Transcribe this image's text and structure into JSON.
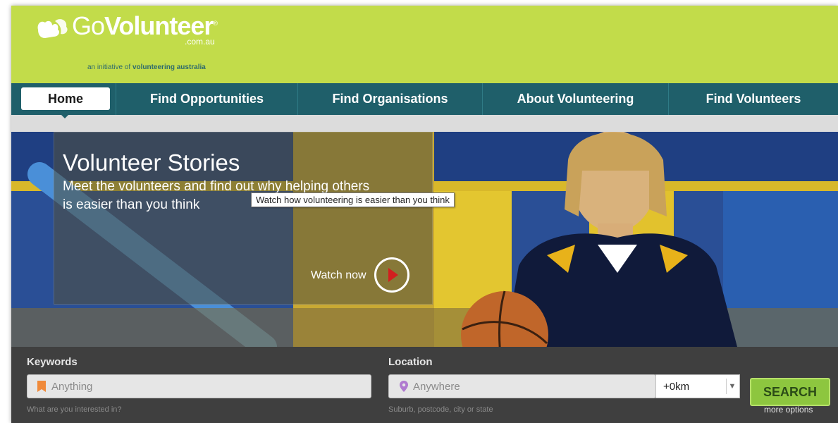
{
  "brand": {
    "name_light": "Go",
    "name_bold": "Volunteer",
    "domain": ".com.au",
    "trademark": "®",
    "tagline_prefix": "an initiative of",
    "tagline_org": "volunteering australia",
    "color_header": "#c2dc4a",
    "color_nav": "#1f5f6a"
  },
  "nav": {
    "items": [
      {
        "label": "Home",
        "active": true
      },
      {
        "label": "Find Opportunities"
      },
      {
        "label": "Find Organisations"
      },
      {
        "label": "About Volunteering"
      },
      {
        "label": "Find Volunteers"
      }
    ]
  },
  "hero": {
    "title": "Volunteer Stories",
    "description": "Meet the volunteers and find out why helping others is easier than you think",
    "cta_label": "Watch now",
    "tooltip": "Watch how volunteering is easier than you think"
  },
  "search": {
    "keywords_label": "Keywords",
    "keywords_placeholder": "Anything",
    "keywords_helper": "What are you interested in?",
    "location_label": "Location",
    "location_placeholder": "Anywhere",
    "location_helper": "Suburb, postcode, city or state",
    "radius_value": "+0km",
    "search_button": "SEARCH",
    "more_options": "more options"
  }
}
